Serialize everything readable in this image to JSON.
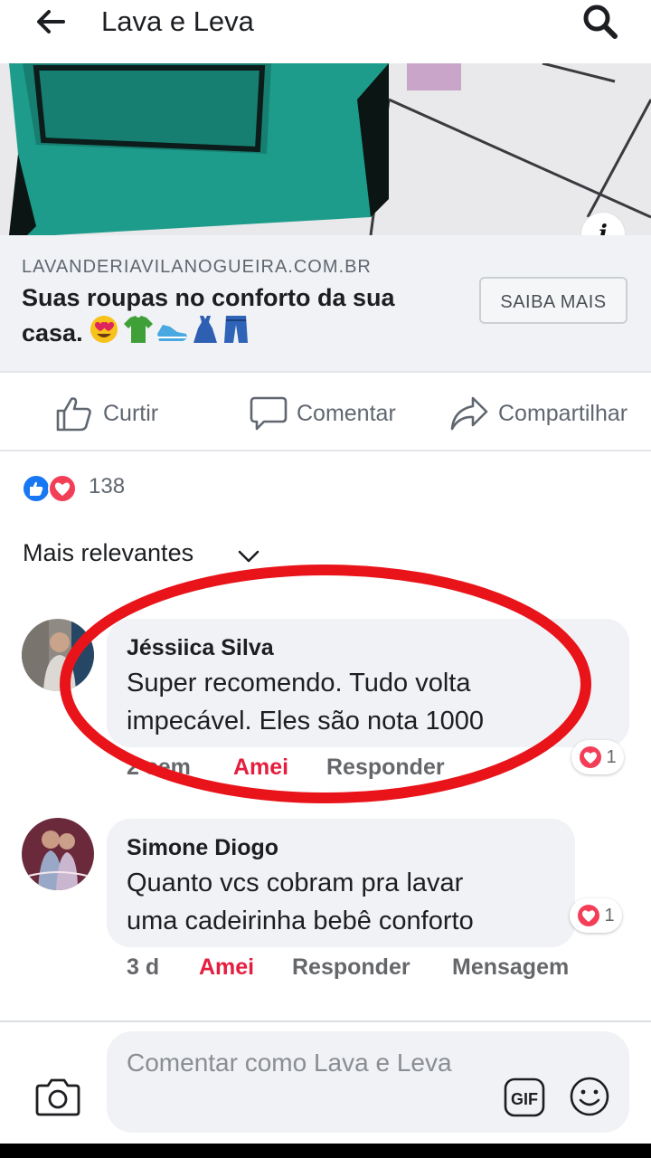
{
  "header": {
    "title": "Lava e Leva"
  },
  "ad": {
    "domain": "LAVANDERIAVILANOGUEIRA.COM.BR",
    "headline": "Suas roupas no conforto da sua casa.",
    "emojis": "😍👕👟👗👖",
    "cta_label": "SAIBA MAIS"
  },
  "actions": {
    "like_label": "Curtir",
    "comment_label": "Comentar",
    "share_label": "Compartilhar"
  },
  "reactions": {
    "count": "138",
    "types": [
      "like-icon",
      "love-icon"
    ]
  },
  "sort": {
    "label": "Mais relevantes"
  },
  "comments": [
    {
      "author": "Jéssiica Silva",
      "text_line1": "Super recomendo. Tudo volta",
      "text_line2": "impecável. Eles são nota 1000",
      "time": "2 sem",
      "reaction_label": "Amei",
      "reply_label": "Responder",
      "reaction_count": "1"
    },
    {
      "author": "Simone Diogo",
      "text_line1": "Quanto vcs cobram pra lavar",
      "text_line2": "uma cadeirinha bebê conforto",
      "time": "3 d",
      "reaction_label": "Amei",
      "reply_label": "Responder",
      "message_label": "Mensagem",
      "reaction_count": "1"
    }
  ],
  "composer": {
    "placeholder": "Comentar como Lava e Leva",
    "gif_label": "GIF"
  },
  "colors": {
    "accent_blue": "#1877f2",
    "love_red": "#e41e3f",
    "highlight_circle": "#e8141a"
  }
}
